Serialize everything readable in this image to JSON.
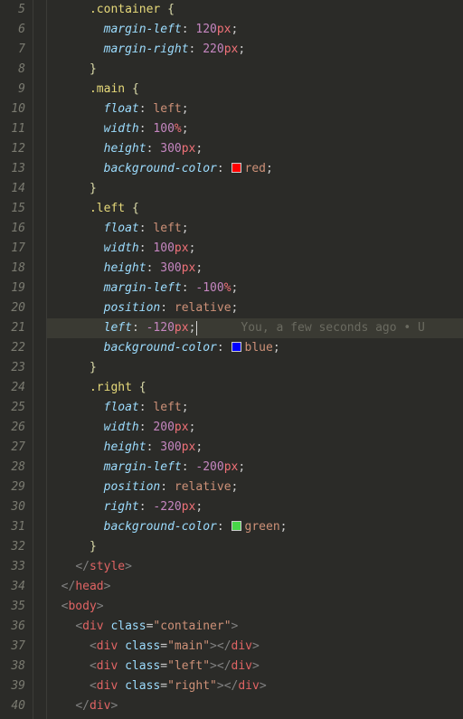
{
  "gutter": {
    "start": 5,
    "end": 40
  },
  "highlight_line": 21,
  "lens": {
    "line": 21,
    "text": "You, a few seconds ago • U"
  },
  "swatches": {
    "red": "#ff0000",
    "blue": "#0000ff",
    "green": "#48d648"
  },
  "code": [
    {
      "n": 5,
      "indent": 3,
      "t": "sel-open",
      "selector": ".container"
    },
    {
      "n": 6,
      "indent": 4,
      "t": "decl",
      "prop": "margin-left",
      "num": "120",
      "unit": "px"
    },
    {
      "n": 7,
      "indent": 4,
      "t": "decl",
      "prop": "margin-right",
      "num": "220",
      "unit": "px"
    },
    {
      "n": 8,
      "indent": 3,
      "t": "close"
    },
    {
      "n": 9,
      "indent": 3,
      "t": "sel-open",
      "selector": ".main"
    },
    {
      "n": 10,
      "indent": 4,
      "t": "decl",
      "prop": "float",
      "val": "left"
    },
    {
      "n": 11,
      "indent": 4,
      "t": "decl",
      "prop": "width",
      "num": "100",
      "unit": "%"
    },
    {
      "n": 12,
      "indent": 4,
      "t": "decl",
      "prop": "height",
      "num": "300",
      "unit": "px"
    },
    {
      "n": 13,
      "indent": 4,
      "t": "decl-color",
      "prop": "background-color",
      "color": "red"
    },
    {
      "n": 14,
      "indent": 3,
      "t": "close"
    },
    {
      "n": 15,
      "indent": 3,
      "t": "sel-open",
      "selector": ".left"
    },
    {
      "n": 16,
      "indent": 4,
      "t": "decl",
      "prop": "float",
      "val": "left"
    },
    {
      "n": 17,
      "indent": 4,
      "t": "decl",
      "prop": "width",
      "num": "100",
      "unit": "px"
    },
    {
      "n": 18,
      "indent": 4,
      "t": "decl",
      "prop": "height",
      "num": "300",
      "unit": "px"
    },
    {
      "n": 19,
      "indent": 4,
      "t": "decl",
      "prop": "margin-left",
      "num": "-100",
      "unit": "%"
    },
    {
      "n": 20,
      "indent": 4,
      "t": "decl",
      "prop": "position",
      "val": "relative"
    },
    {
      "n": 21,
      "indent": 4,
      "t": "decl",
      "prop": "left",
      "num": "-120",
      "unit": "px",
      "cursor": true
    },
    {
      "n": 22,
      "indent": 4,
      "t": "decl-color",
      "prop": "background-color",
      "color": "blue"
    },
    {
      "n": 23,
      "indent": 3,
      "t": "close"
    },
    {
      "n": 24,
      "indent": 3,
      "t": "sel-open",
      "selector": ".right"
    },
    {
      "n": 25,
      "indent": 4,
      "t": "decl",
      "prop": "float",
      "val": "left"
    },
    {
      "n": 26,
      "indent": 4,
      "t": "decl",
      "prop": "width",
      "num": "200",
      "unit": "px"
    },
    {
      "n": 27,
      "indent": 4,
      "t": "decl",
      "prop": "height",
      "num": "300",
      "unit": "px"
    },
    {
      "n": 28,
      "indent": 4,
      "t": "decl",
      "prop": "margin-left",
      "num": "-200",
      "unit": "px"
    },
    {
      "n": 29,
      "indent": 4,
      "t": "decl",
      "prop": "position",
      "val": "relative"
    },
    {
      "n": 30,
      "indent": 4,
      "t": "decl",
      "prop": "right",
      "num": "-220",
      "unit": "px"
    },
    {
      "n": 31,
      "indent": 4,
      "t": "decl-color",
      "prop": "background-color",
      "color": "green"
    },
    {
      "n": 32,
      "indent": 3,
      "t": "close"
    },
    {
      "n": 33,
      "indent": 2,
      "t": "tag-close",
      "tag": "style"
    },
    {
      "n": 34,
      "indent": 1,
      "t": "tag-close",
      "tag": "head"
    },
    {
      "n": 35,
      "indent": 1,
      "t": "tag-open",
      "tag": "body"
    },
    {
      "n": 36,
      "indent": 2,
      "t": "tag-attr",
      "tag": "div",
      "attr": "class",
      "value": "container"
    },
    {
      "n": 37,
      "indent": 3,
      "t": "tag-pair",
      "tag": "div",
      "attr": "class",
      "value": "main"
    },
    {
      "n": 38,
      "indent": 3,
      "t": "tag-pair",
      "tag": "div",
      "attr": "class",
      "value": "left"
    },
    {
      "n": 39,
      "indent": 3,
      "t": "tag-pair",
      "tag": "div",
      "attr": "class",
      "value": "right"
    },
    {
      "n": 40,
      "indent": 2,
      "t": "tag-close",
      "tag": "div"
    }
  ]
}
